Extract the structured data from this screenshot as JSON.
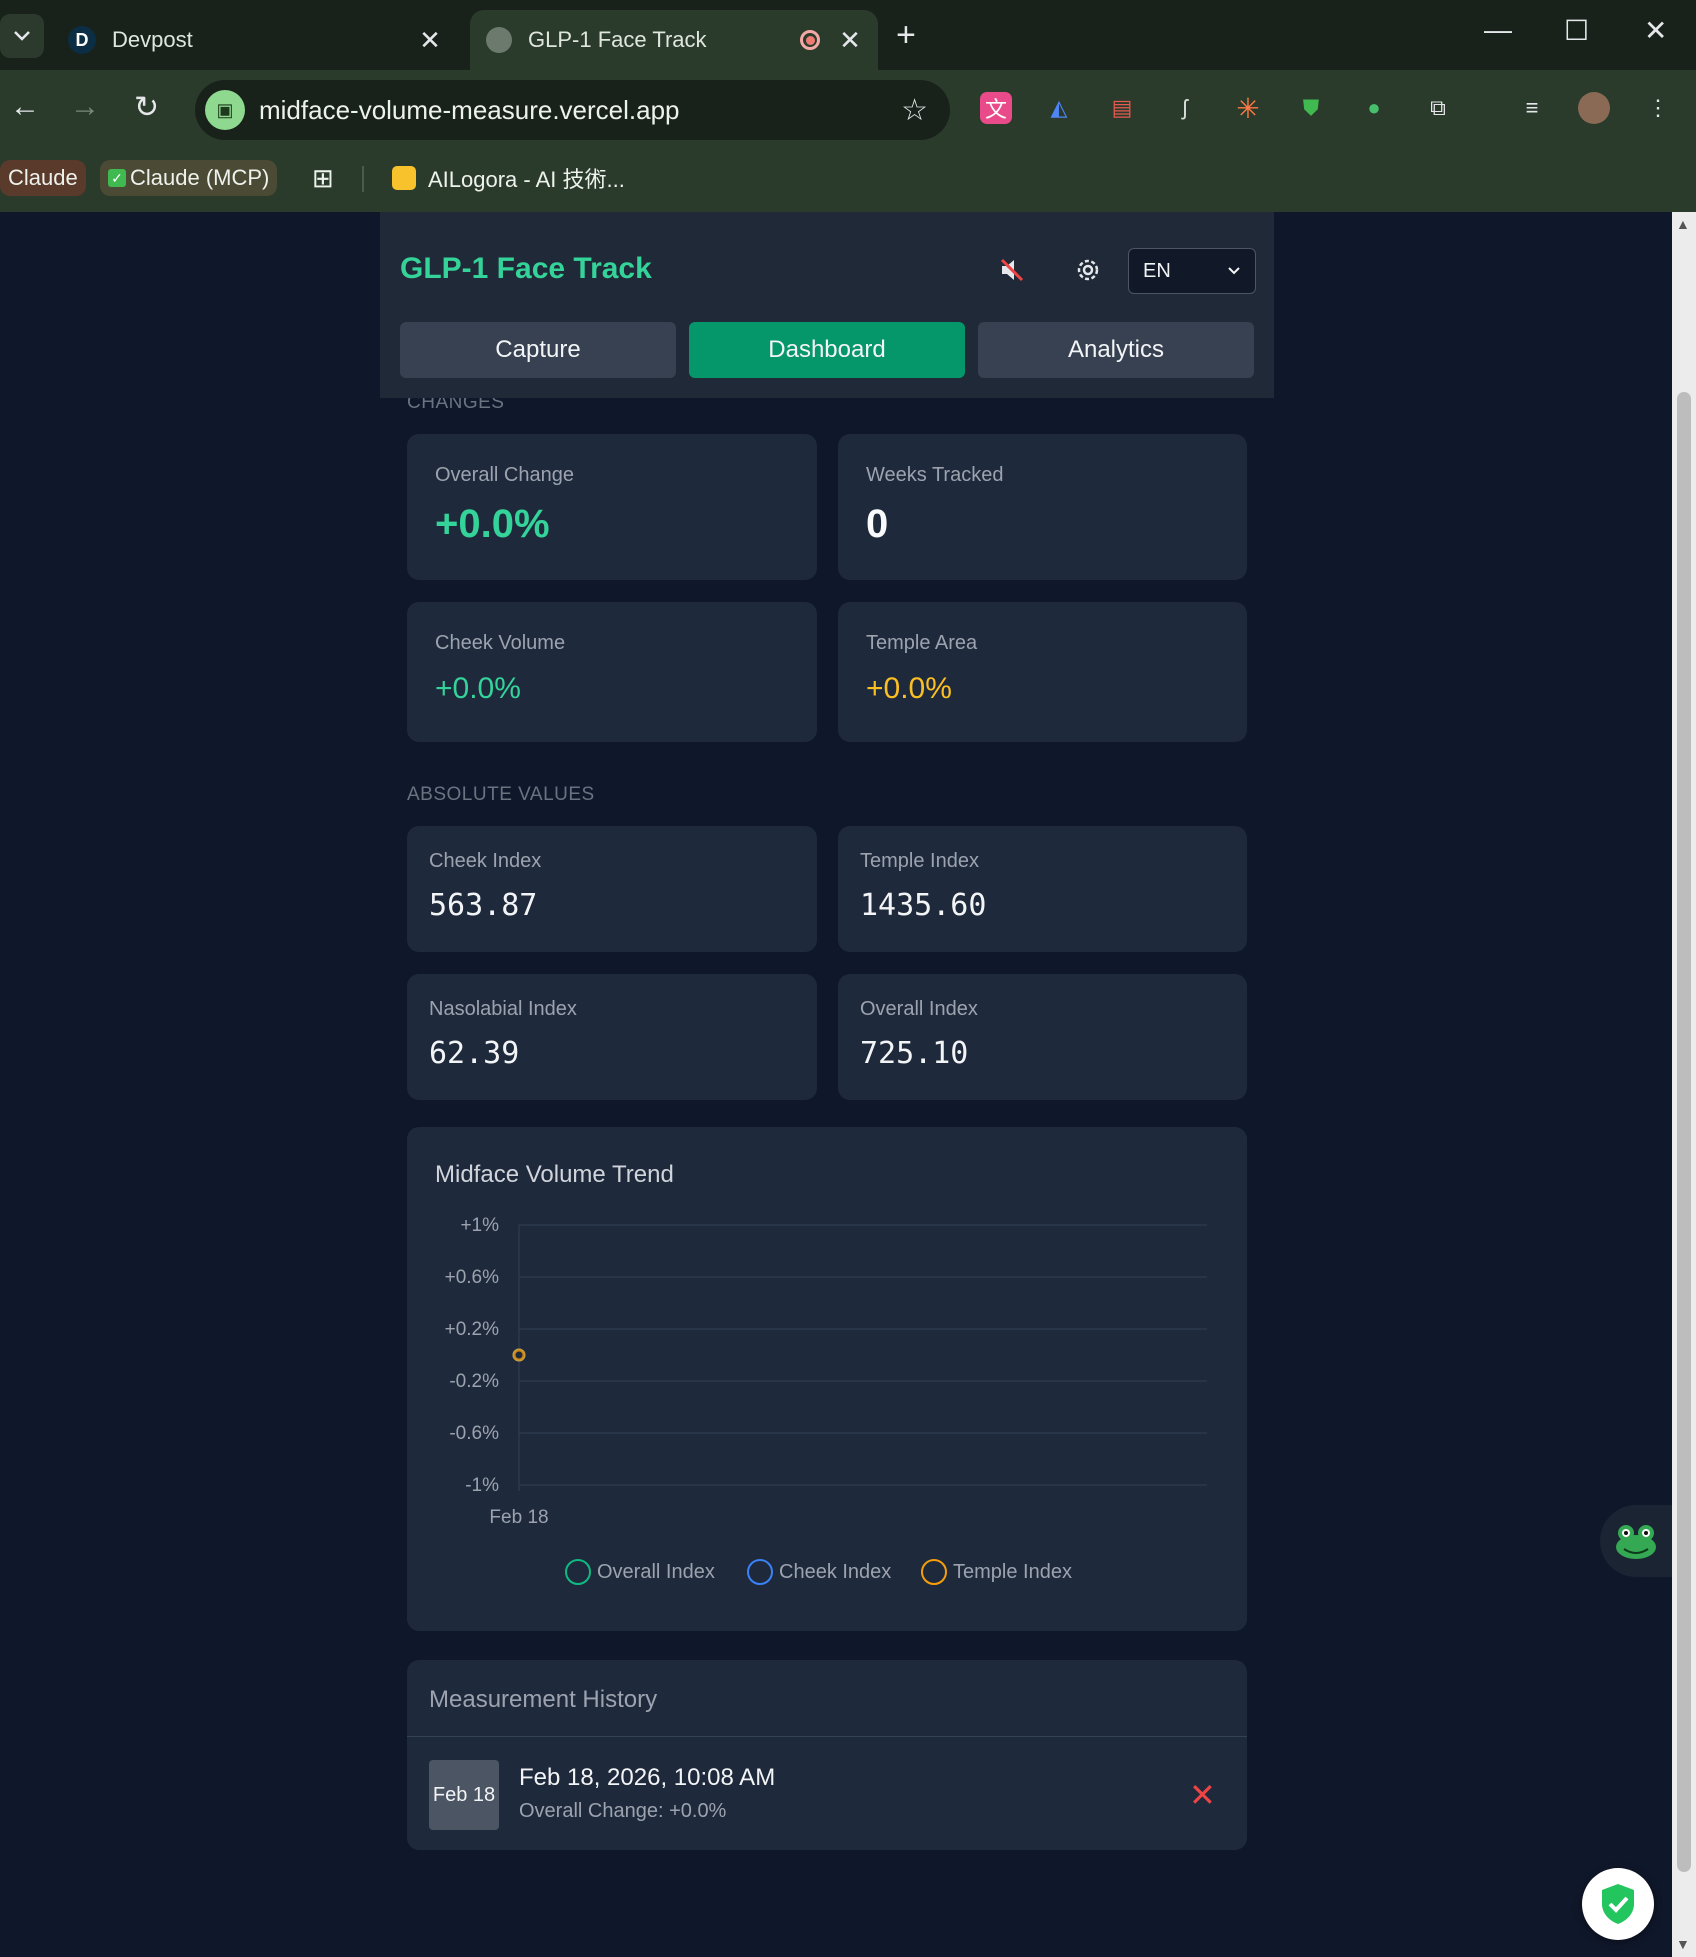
{
  "browser": {
    "tabs": [
      {
        "title": "Devpost",
        "favicon": "D",
        "active": false
      },
      {
        "title": "GLP-1 Face Track",
        "favicon": "globe-icon",
        "active": true
      }
    ],
    "url": "midface-volume-measure.vercel.app",
    "bookmarks": [
      {
        "label": "Claude"
      },
      {
        "label": "Claude (MCP)"
      },
      {
        "label": "AILogora - AI 技術..."
      }
    ]
  },
  "app": {
    "title": "GLP-1 Face Track",
    "language": "EN",
    "nav": {
      "capture": "Capture",
      "dashboard": "Dashboard",
      "analytics": "Analytics"
    },
    "active_tab": "Dashboard"
  },
  "changes": {
    "section_label": "CHANGES",
    "overall_label": "Overall Change",
    "overall_value": "+0.0%",
    "weeks_label": "Weeks Tracked",
    "weeks_value": "0",
    "cheek_label": "Cheek Volume",
    "cheek_value": "+0.0%",
    "temple_label": "Temple Area",
    "temple_value": "+0.0%"
  },
  "absolute": {
    "section_label": "ABSOLUTE VALUES",
    "cheek_label": "Cheek Index",
    "cheek_value": "563.87",
    "temple_label": "Temple Index",
    "temple_value": "1435.60",
    "naso_label": "Nasolabial Index",
    "naso_value": "62.39",
    "overall_label": "Overall Index",
    "overall_value": "725.10"
  },
  "colors": {
    "accent": "#059669",
    "brand": "#34d399",
    "overall": "#10b981",
    "cheek": "#3b82f6",
    "temple": "#f59e0b"
  },
  "chart_data": {
    "type": "line",
    "title": "Midface Volume Trend",
    "x": [
      "Feb 18"
    ],
    "series": [
      {
        "name": "Overall Index",
        "values": [
          0.0
        ]
      },
      {
        "name": "Cheek Index",
        "values": [
          0.0
        ]
      },
      {
        "name": "Temple Index",
        "values": [
          0.0
        ]
      }
    ],
    "ylim": [
      -1,
      1
    ],
    "yticks": [
      "+1%",
      "+0.6%",
      "+0.2%",
      "-0.2%",
      "-0.6%",
      "-1%"
    ],
    "grid": true,
    "legend": "bottom"
  },
  "history": {
    "title": "Measurement History",
    "items": [
      {
        "thumb": "Feb 18",
        "date": "Feb 18, 2026, 10:08 AM",
        "summary": "Overall Change: +0.0%"
      }
    ]
  }
}
